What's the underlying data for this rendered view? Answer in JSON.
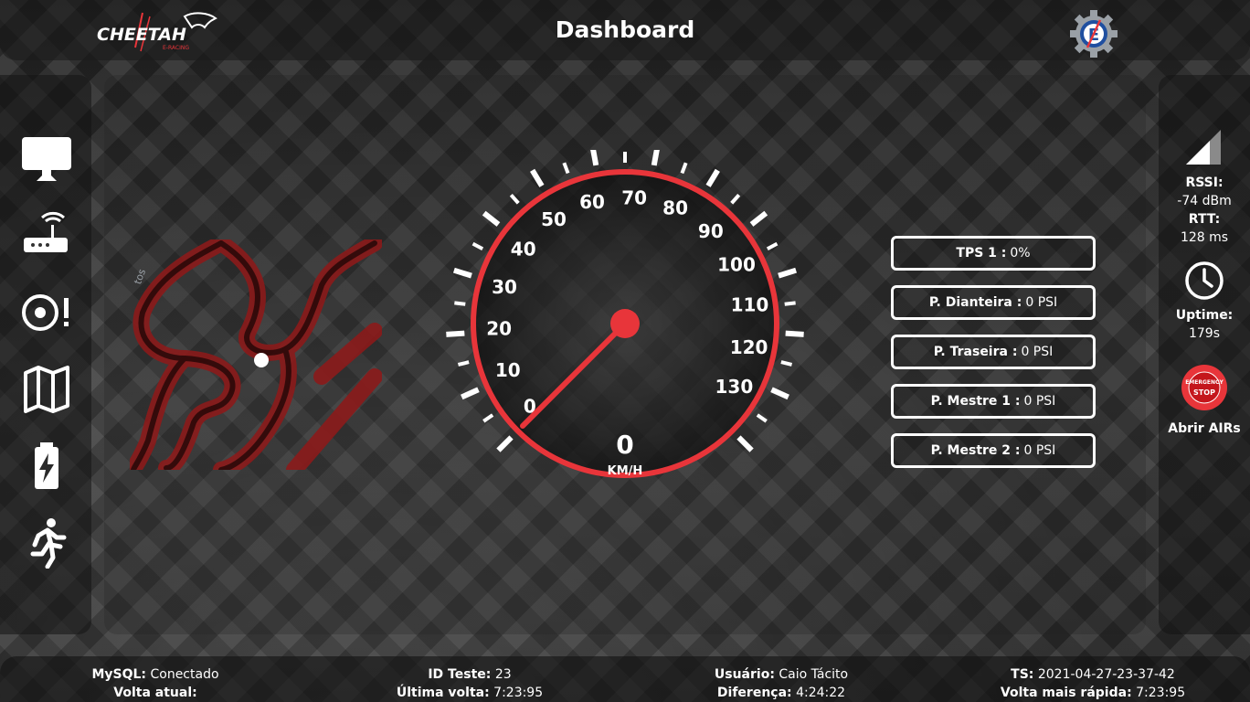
{
  "header": {
    "title": "Dashboard",
    "logo_text": "CHEETAH",
    "logo_subtext": "E-RACING"
  },
  "colors": {
    "accent": "#e8353a",
    "track": "#8b1a1a",
    "text": "#ffffff"
  },
  "sidebar": {
    "items": [
      {
        "icon": "monitor-icon"
      },
      {
        "icon": "router-icon"
      },
      {
        "icon": "tire-alert-icon"
      },
      {
        "icon": "map-icon"
      },
      {
        "icon": "battery-charging-icon"
      },
      {
        "icon": "running-person-icon"
      }
    ]
  },
  "map": {
    "label": "tos"
  },
  "speedometer": {
    "value": "0",
    "unit": "KM/H",
    "ticks": [
      "0",
      "10",
      "20",
      "30",
      "40",
      "50",
      "60",
      "70",
      "80",
      "90",
      "100",
      "110",
      "120",
      "130"
    ]
  },
  "sensors": [
    {
      "label": "TPS 1 :",
      "value": "0%"
    },
    {
      "label": "P. Dianteira :",
      "value": "0 PSI"
    },
    {
      "label": "P. Traseira :",
      "value": "0 PSI"
    },
    {
      "label": "P. Mestre 1 :",
      "value": "0 PSI"
    },
    {
      "label": "P. Mestre 2 :",
      "value": "0 PSI"
    }
  ],
  "status": {
    "rssi_label": "RSSI:",
    "rssi_value": "-74 dBm",
    "rtt_label": "RTT:",
    "rtt_value": "128 ms",
    "uptime_label": "Uptime:",
    "uptime_value": "179s",
    "emergency_line1": "EMERGENCY",
    "emergency_line2": "STOP",
    "airs_label": "Abrir AIRs"
  },
  "footer": {
    "mysql_label": "MySQL:",
    "mysql_value": "Conectado",
    "lap_label": "Volta atual:",
    "lap_value": "",
    "test_label": "ID Teste:",
    "test_value": "23",
    "last_lap_label": "Última volta:",
    "last_lap_value": "7:23:95",
    "user_label": "Usuário:",
    "user_value": "Caio Tácito",
    "diff_label": "Diferença:",
    "diff_value": "4:24:22",
    "ts_label": "TS:",
    "ts_value": "2021-04-27-23-37-42",
    "best_label": "Volta mais rápida:",
    "best_value": "7:23:95"
  }
}
